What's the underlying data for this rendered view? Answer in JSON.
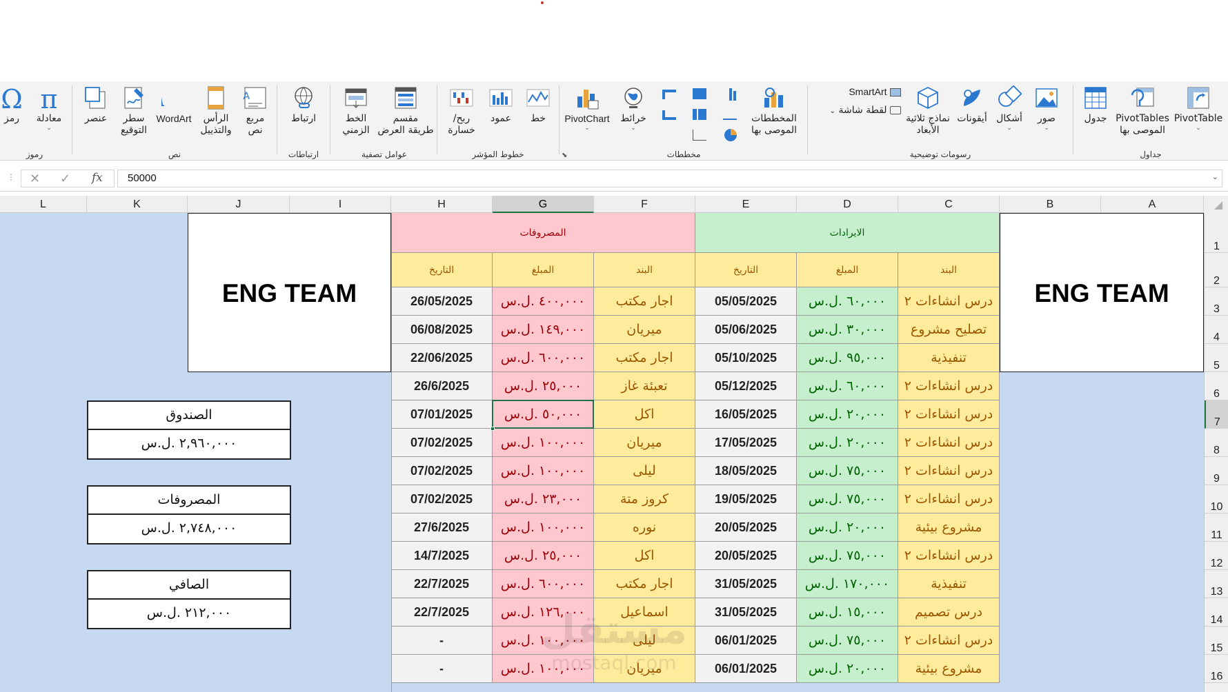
{
  "ribbon": {
    "groups": [
      {
        "name": "tables",
        "label": "جداول"
      },
      {
        "name": "illustrations",
        "label": "رسومات توضيحية"
      },
      {
        "name": "charts",
        "label": "مخططات"
      },
      {
        "name": "sparklines",
        "label": "خطوط المؤشر"
      },
      {
        "name": "filters",
        "label": "عوامل تصفية"
      },
      {
        "name": "links",
        "label": "ارتباطات"
      },
      {
        "name": "text",
        "label": "نص"
      },
      {
        "name": "symbols",
        "label": "رموز"
      }
    ],
    "buttons": {
      "pivottable": "PivotTable",
      "recommended_pivot_1": "PivotTables",
      "recommended_pivot_2": "الموصى بها",
      "table": "جدول",
      "pictures": "صور",
      "shapes": "أشكال",
      "icons": "أيقونات",
      "models_1": "نماذج ثلاثية",
      "models_2": "الأبعاد",
      "smartart": "SmartArt",
      "screenshot": "لقطة شاشة",
      "recommended_charts_1": "المخططات",
      "recommended_charts_2": "الموصى بها",
      "maps": "خرائط",
      "pivotchart": "PivotChart",
      "line": "خط",
      "column": "عمود",
      "winloss_1": "ربح/",
      "winloss_2": "خسارة",
      "slicer_1": "مقسم",
      "slicer_2": "طريقة العرض",
      "timeline_1": "الخط",
      "timeline_2": "الزمني",
      "link": "ارتباط",
      "textbox_1": "مربع",
      "textbox_2": "نص",
      "headerfooter_1": "الرأس",
      "headerfooter_2": "والتذييل",
      "wordart": "WordArt",
      "signature_1": "سطر",
      "signature_2": "التوقيع",
      "object": "عنصر",
      "equation": "معادلة",
      "symbol": "رمز"
    }
  },
  "formula_bar": {
    "value": "50000",
    "fx": "fx",
    "cancel": "✕",
    "enter": "✓"
  },
  "columns": [
    "L",
    "K",
    "J",
    "I",
    "H",
    "G",
    "F",
    "E",
    "D",
    "C",
    "B",
    "A"
  ],
  "selected_column": "G",
  "rows": [
    "1",
    "2",
    "3",
    "4",
    "5",
    "6",
    "7",
    "8",
    "9",
    "10",
    "11",
    "12",
    "13",
    "14",
    "15",
    "16"
  ],
  "selected_row": "7",
  "sheet": {
    "logo_text": "ENG TEAM",
    "revenue_header": "الايرادات",
    "expense_header": "المصروفات",
    "sub_headers": {
      "item": "البند",
      "amount": "المبلغ",
      "date": "التاريخ"
    },
    "revenue_rows": [
      {
        "item": "درس انشاءات ٢",
        "amount": "٦٠,٠٠٠ .ل.س",
        "date": "05/05/2025"
      },
      {
        "item": "تصليح مشروع",
        "amount": "٣٠,٠٠٠ .ل.س",
        "date": "05/06/2025"
      },
      {
        "item": "تنفيذية",
        "amount": "٩٥,٠٠٠ .ل.س",
        "date": "05/10/2025"
      },
      {
        "item": "درس انشاءات ٢",
        "amount": "٦٠,٠٠٠ .ل.س",
        "date": "05/12/2025"
      },
      {
        "item": "درس انشاءات ٢",
        "amount": "٢٠,٠٠٠ .ل.س",
        "date": "16/05/2025"
      },
      {
        "item": "درس انشاءات ٢",
        "amount": "٢٠,٠٠٠ .ل.س",
        "date": "17/05/2025"
      },
      {
        "item": "درس انشاءات ٢",
        "amount": "٧٥,٠٠٠ .ل.س",
        "date": "18/05/2025"
      },
      {
        "item": "درس انشاءات ٢",
        "amount": "٧٥,٠٠٠ .ل.س",
        "date": "19/05/2025"
      },
      {
        "item": "مشروع بيئية",
        "amount": "٢٠,٠٠٠ .ل.س",
        "date": "20/05/2025"
      },
      {
        "item": "درس انشاءات ٢",
        "amount": "٧٥,٠٠٠ .ل.س",
        "date": "20/05/2025"
      },
      {
        "item": "تنفيذية",
        "amount": "١٧٠,٠٠٠ .ل.س",
        "date": "31/05/2025"
      },
      {
        "item": "درس تصميم",
        "amount": "١٥,٠٠٠ .ل.س",
        "date": "31/05/2025"
      },
      {
        "item": "درس انشاءات ٢",
        "amount": "٧٥,٠٠٠ .ل.س",
        "date": "06/01/2025"
      },
      {
        "item": "مشروع بيئية",
        "amount": "٢٠,٠٠٠ .ل.س",
        "date": "06/01/2025"
      }
    ],
    "expense_rows": [
      {
        "item": "اجار مكتب",
        "amount": "٤٠٠,٠٠٠ .ل.س",
        "date": "26/05/2025"
      },
      {
        "item": "ميريان",
        "amount": "١٤٩,٠٠٠ .ل.س",
        "date": "06/08/2025"
      },
      {
        "item": "اجار مكتب",
        "amount": "٦٠٠,٠٠٠ .ل.س",
        "date": "22/06/2025"
      },
      {
        "item": "تعبئة غاز",
        "amount": "٢٥,٠٠٠ .ل.س",
        "date": "26/6/2025"
      },
      {
        "item": "اكل",
        "amount": "٥٠,٠٠٠ .ل.س",
        "date": "07/01/2025"
      },
      {
        "item": "ميريان",
        "amount": "١٠٠,٠٠٠ .ل.س",
        "date": "07/02/2025"
      },
      {
        "item": "ليلى",
        "amount": "١٠٠,٠٠٠ .ل.س",
        "date": "07/02/2025"
      },
      {
        "item": "كروز متة",
        "amount": "٢٣,٠٠٠ .ل.س",
        "date": "07/02/2025"
      },
      {
        "item": "نوره",
        "amount": "١٠٠,٠٠٠ .ل.س",
        "date": "27/6/2025"
      },
      {
        "item": "اكل",
        "amount": "٢٥,٠٠٠ .ل.س",
        "date": "14/7/2025"
      },
      {
        "item": "اجار مكتب",
        "amount": "٦٠٠,٠٠٠ .ل.س",
        "date": "22/7/2025"
      },
      {
        "item": "اسماعيل",
        "amount": "١٢٦,٠٠٠ .ل.س",
        "date": "22/7/2025"
      },
      {
        "item": "ليلى",
        "amount": "١٠٠,٠٠٠ .ل.س",
        "date": "-"
      },
      {
        "item": "ميريان",
        "amount": "١٠٠,٠٠٠ .ل.س",
        "date": "-"
      }
    ],
    "summary": [
      {
        "title": "الصندوق",
        "value": "٢,٩٦٠,٠٠٠ .ل.س"
      },
      {
        "title": "المصروفات",
        "value": "٢,٧٤٨,٠٠٠ .ل.س"
      },
      {
        "title": "الصافي",
        "value": "٢١٢,٠٠٠ .ل.س"
      }
    ]
  },
  "watermark": {
    "line1": "مستقل",
    "line2": "mostaql.com"
  },
  "colors": {
    "ribbon_bg": "#f3f3f3",
    "sheet_bg": "#c6d9f0",
    "revenue_green": "#c6efce",
    "expense_pink": "#ffc7ce",
    "header_yellow": "#ffeb9c",
    "excel_green": "#217346"
  }
}
